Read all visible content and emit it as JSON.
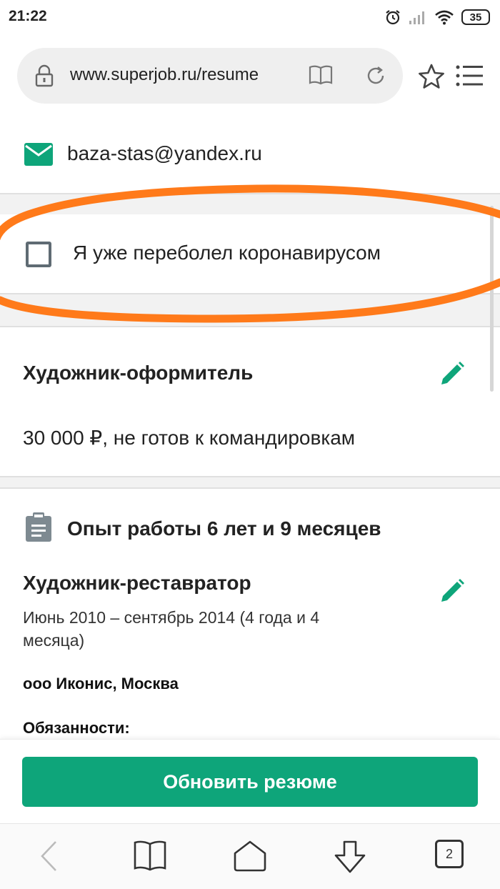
{
  "status_bar": {
    "time": "21:22",
    "battery": "35"
  },
  "browser": {
    "url": "www.superjob.ru/resume"
  },
  "contact": {
    "email": "baza-stas@yandex.ru"
  },
  "covid": {
    "label": "Я уже переболел коронавирусом",
    "checked": false
  },
  "resume": {
    "title": "Художник-оформитель",
    "salary": "30 000 ₽, не готов к командировкам"
  },
  "experience": {
    "heading": "Опыт работы 6 лет и 9 месяцев",
    "position": "Художник-реставратор",
    "period": "Июнь 2010 – сентябрь 2014 (4 года и 4 месяца)",
    "company": "ооо Иконис, Москва",
    "duties_label": "Обязанности:"
  },
  "actions": {
    "update_button": "Обновить резюме"
  },
  "nav": {
    "tabs_count": "2"
  },
  "colors": {
    "accent": "#0ea57a",
    "annotation": "#ff7a1a"
  }
}
